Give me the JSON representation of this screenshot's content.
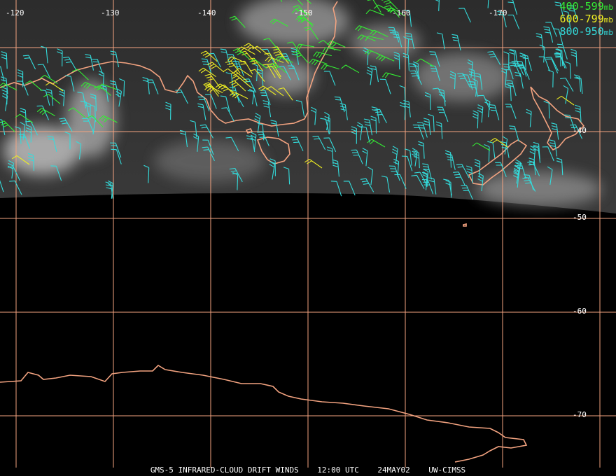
{
  "legend": {
    "levels": [
      {
        "label": "400-599",
        "unit": "mb",
        "color": "#33ee33"
      },
      {
        "label": "600-799",
        "unit": "mb",
        "color": "#eeee22"
      },
      {
        "label": "800-950",
        "unit": "mb",
        "color": "#33dddd"
      }
    ]
  },
  "grid": {
    "color": "#f3a380",
    "longitudes": [
      "-120",
      "-130",
      "-140",
      "-150",
      "-160",
      "-170"
    ],
    "latitudes": [
      "-40",
      "-50",
      "-60",
      "-70"
    ]
  },
  "coast_color": "#f3a380",
  "footer": {
    "product": "GMS-5 INFRARED-CLOUD DRIFT WINDS",
    "time": "12:00 UTC",
    "date": "24MAY02",
    "source": "UW-CIMSS"
  }
}
